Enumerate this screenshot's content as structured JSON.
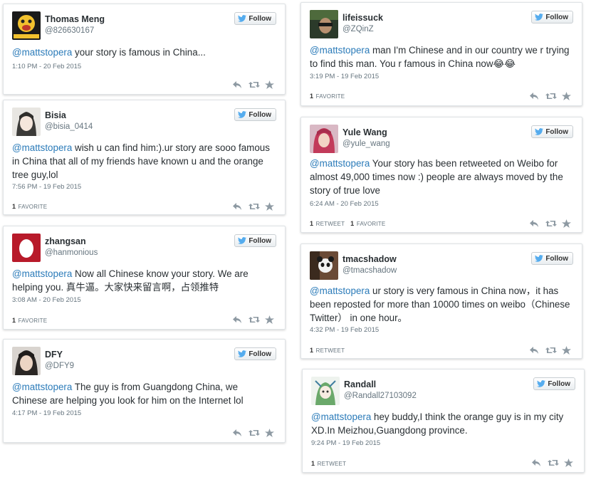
{
  "tweets": [
    {
      "name": "Thomas Meng",
      "handle": "@826630167",
      "mention": "@mattstopera",
      "text": " your story is famous in China...",
      "time": "1:10 PM - 20 Feb 2015",
      "retweets": "",
      "favorites": "",
      "avatar": "yellow-cartoon-avatar"
    },
    {
      "name": "Bisia",
      "handle": "@bisia_0414",
      "mention": "@mattstopera",
      "text": " wish u can find him:).ur story are sooo famous in China that all of my friends have known u and the orange tree guy,lol",
      "time": "7:56 PM - 19 Feb 2015",
      "retweets": "",
      "favorites": "1",
      "avatar": "anime-girl-avatar"
    },
    {
      "name": "zhangsan",
      "handle": "@hanmonious",
      "mention": "@mattstopera",
      "text": " Now all Chinese know your story. We are helping you. 真牛逼。大家快来留言啊，占领推特",
      "time": "3:08 AM - 20 Feb 2015",
      "retweets": "",
      "favorites": "1",
      "avatar": "red-egg-avatar"
    },
    {
      "name": "DFY",
      "handle": "@DFY9",
      "mention": "@mattstopera",
      "text": " The guy is from Guangdong China, we Chinese are helping you look for him on the Internet lol",
      "time": "4:17 PM - 19 Feb 2015",
      "retweets": "",
      "favorites": "",
      "avatar": "person-photo-avatar"
    },
    {
      "name": "lifeissuck",
      "handle": "@ZQinZ",
      "mention": "@mattstopera",
      "text": " man I'm  Chinese and in our country we r trying to find this man. You r famous in China now😂😂",
      "time": "3:19 PM - 19 Feb 2015",
      "retweets": "",
      "favorites": "1",
      "avatar": "dark-photo-avatar"
    },
    {
      "name": "Yule Wang",
      "handle": "@yule_wang",
      "mention": "@mattstopera",
      "text": " Your story has been retweeted on Weibo for almost 49,000 times now :) people are always moved by the story of true love",
      "time": "6:24 AM - 20 Feb 2015",
      "retweets": "1",
      "favorites": "1",
      "avatar": "pink-hair-avatar"
    },
    {
      "name": "tmacshadow",
      "handle": "@tmacshadow",
      "mention": "@mattstopera",
      "text": " ur story is very famous in China now，it has been reposted for more than 10000 times on weibo（Chinese Twitter） in one hour。",
      "time": "4:32 PM - 19 Feb 2015",
      "retweets": "1",
      "favorites": "",
      "avatar": "panda-avatar"
    },
    {
      "name": "Randall",
      "handle": "@Randall27103092",
      "mention": "@mattstopera",
      "text": " hey buddy,I think the orange guy is in my city XD.In Meizhou,Guangdong province.",
      "time": "9:24 PM - 19 Feb 2015",
      "retweets": "1",
      "favorites": "",
      "avatar": "green-cartoon-avatar"
    }
  ],
  "labels": {
    "follow": "Follow",
    "retweet": "RETWEET",
    "favorite": "FAVORITE"
  },
  "colors": {
    "mention": "#2b7bb9",
    "follow_bird": "#55acee",
    "icon": "#aab8c2"
  }
}
